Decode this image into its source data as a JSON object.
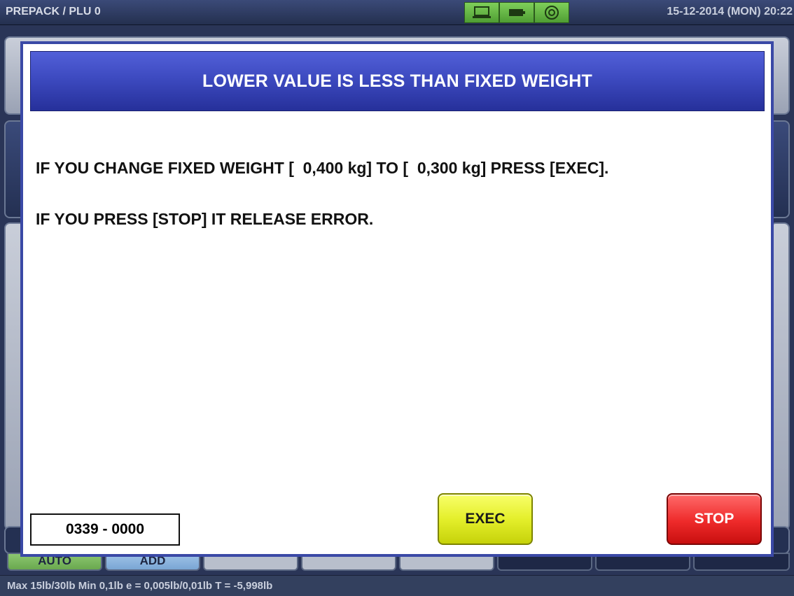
{
  "topbar": {
    "mode_label": "PREPACK / PLU 0",
    "datetime": "15-12-2014 (MON)  20:22",
    "status_icons": [
      "laptop-icon",
      "battery-icon",
      "network-icon"
    ],
    "icon_color": "#6abf45"
  },
  "background": {
    "tabs": [
      "AUTO",
      "ADD",
      "",
      "",
      "",
      "",
      "",
      ""
    ]
  },
  "modal": {
    "title": "LOWER VALUE IS LESS THAN FIXED WEIGHT",
    "line1": "IF YOU CHANGE FIXED WEIGHT [  0,400 kg] TO [  0,300 kg] PRESS [EXEC].",
    "line2": "IF YOU PRESS [STOP] IT RELEASE ERROR.",
    "error_code": "0339 - 0000",
    "exec_label": "EXEC",
    "stop_label": "STOP",
    "header_color": "#3d4ac0",
    "exec_color": "#e4ef2b",
    "stop_color": "#ee2a2a"
  },
  "footer": {
    "spec": "Max 15lb/30lb  Min 0,1lb  e = 0,005lb/0,01lb  T = -5,998lb"
  }
}
